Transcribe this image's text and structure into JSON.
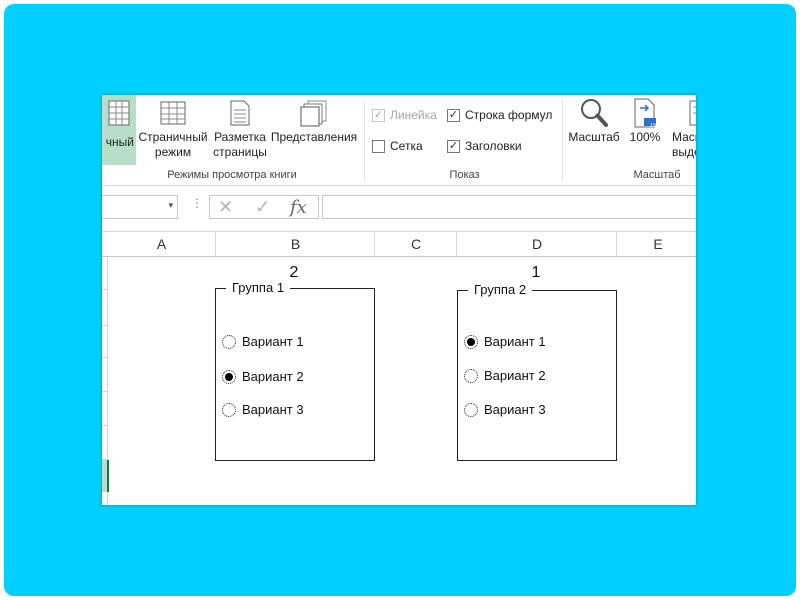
{
  "ribbon": {
    "view_modes": {
      "normal": "чный",
      "page_layout_line1": "Страничный",
      "page_layout_line2": "режим",
      "page_break_line1": "Разметка",
      "page_break_line2": "страницы",
      "custom_views": "Представления",
      "group_label": "Режимы просмотра книги"
    },
    "show": {
      "ruler": "Линейка",
      "formula_bar": "Строка формул",
      "gridlines": "Сетка",
      "headings": "Заголовки",
      "group_label": "Показ",
      "ruler_checked": "✓",
      "formula_bar_checked": "✓",
      "headings_checked": "✓"
    },
    "zoom": {
      "zoom": "Масштаб",
      "zoom_100": "100%",
      "zoom_selection_line1": "Масш",
      "zoom_selection_line2": "выде",
      "group_label": "Масштаб",
      "badge_100": "100"
    }
  },
  "formula_bar": {
    "dots": "⋮",
    "cancel": "✕",
    "enter": "✓",
    "fx": "fx",
    "namebox_dropdown": "▾"
  },
  "columns": [
    "A",
    "B",
    "C",
    "D",
    "E"
  ],
  "sheet": {
    "cell_b1": "2",
    "cell_d1": "1",
    "group1": {
      "title": "Группа 1",
      "options": [
        "Вариант 1",
        "Вариант 2",
        "Вариант 3"
      ],
      "selected_index": 1
    },
    "group2": {
      "title": "Группа 2",
      "options": [
        "Вариант 1",
        "Вариант 2",
        "Вариант 3"
      ],
      "selected_index": 0
    }
  }
}
